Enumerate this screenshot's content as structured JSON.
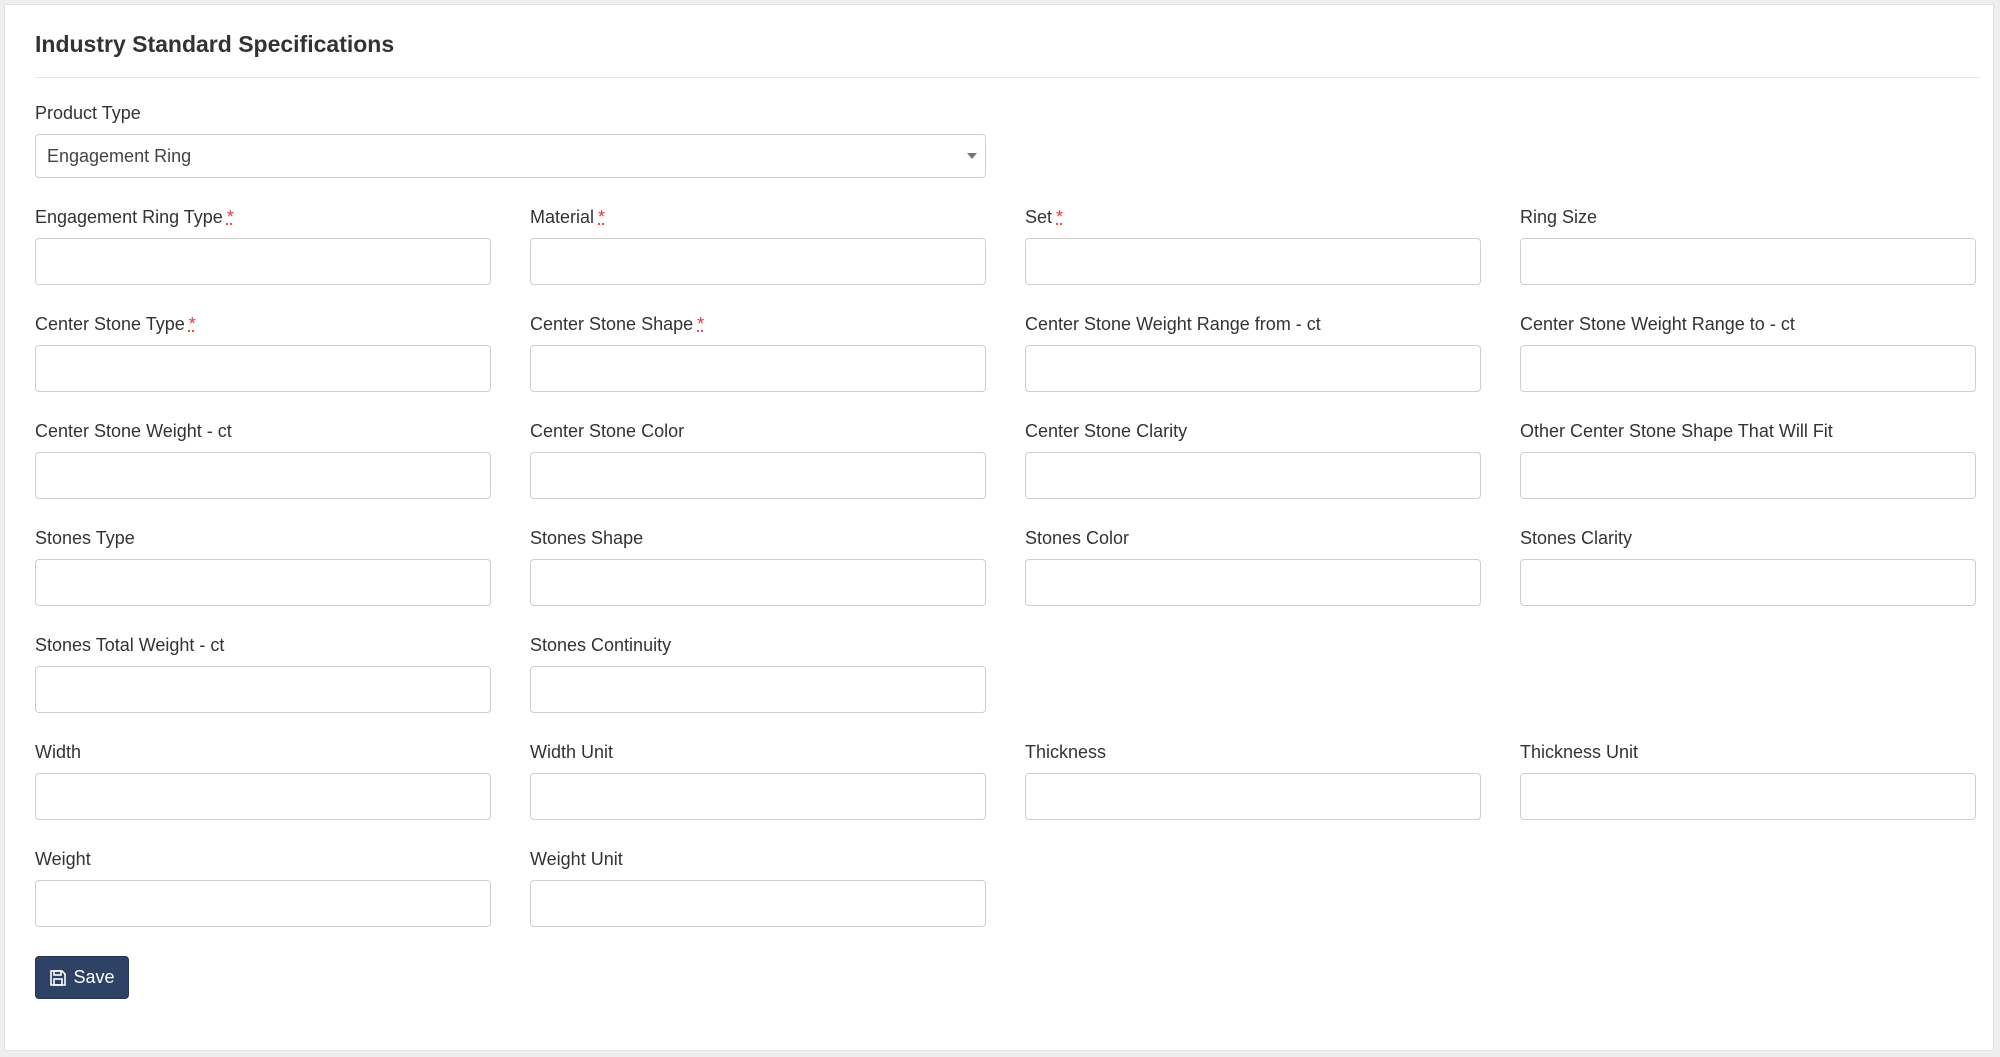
{
  "page": {
    "title": "Industry Standard Specifications"
  },
  "product_type": {
    "label": "Product Type",
    "value": "Engagement Ring"
  },
  "required_marker": "*",
  "fields": {
    "engagement_ring_type": {
      "label": "Engagement Ring Type",
      "value": ""
    },
    "material": {
      "label": "Material",
      "value": ""
    },
    "set": {
      "label": "Set",
      "value": ""
    },
    "ring_size": {
      "label": "Ring Size",
      "value": ""
    },
    "center_stone_type": {
      "label": "Center Stone Type",
      "value": ""
    },
    "center_stone_shape": {
      "label": "Center Stone Shape",
      "value": ""
    },
    "center_stone_weight_from": {
      "label": "Center Stone Weight Range from - ct",
      "value": ""
    },
    "center_stone_weight_to": {
      "label": "Center Stone Weight Range to - ct",
      "value": ""
    },
    "center_stone_weight": {
      "label": "Center Stone Weight - ct",
      "value": ""
    },
    "center_stone_color": {
      "label": "Center Stone Color",
      "value": ""
    },
    "center_stone_clarity": {
      "label": "Center Stone Clarity",
      "value": ""
    },
    "other_center_stone_shape": {
      "label": "Other Center Stone Shape That Will Fit",
      "value": ""
    },
    "stones_type": {
      "label": "Stones Type",
      "value": ""
    },
    "stones_shape": {
      "label": "Stones Shape",
      "value": ""
    },
    "stones_color": {
      "label": "Stones Color",
      "value": ""
    },
    "stones_clarity": {
      "label": "Stones Clarity",
      "value": ""
    },
    "stones_total_weight": {
      "label": "Stones Total Weight - ct",
      "value": ""
    },
    "stones_continuity": {
      "label": "Stones Continuity",
      "value": ""
    },
    "width": {
      "label": "Width",
      "value": ""
    },
    "width_unit": {
      "label": "Width Unit",
      "value": ""
    },
    "thickness": {
      "label": "Thickness",
      "value": ""
    },
    "thickness_unit": {
      "label": "Thickness Unit",
      "value": ""
    },
    "weight": {
      "label": "Weight",
      "value": ""
    },
    "weight_unit": {
      "label": "Weight Unit",
      "value": ""
    }
  },
  "actions": {
    "save_label": "Save",
    "save_icon": "floppy-disk-icon",
    "save_color": "#2e4266"
  },
  "colors": {
    "required": "#e53935",
    "background": "#eeeeee"
  }
}
